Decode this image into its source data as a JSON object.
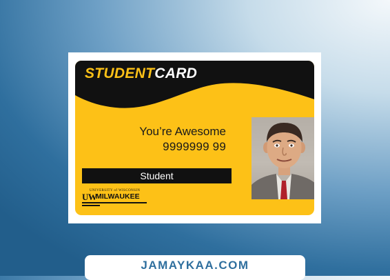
{
  "card": {
    "title_part1": "STUDENT",
    "title_part2": "CARD",
    "holder_name": "You’re Awesome",
    "holder_number": "9999999 99",
    "role": "Student",
    "logo": {
      "small_text": "UNIVERSITY of WISCONSIN",
      "initials": "UW",
      "name": "MILWAUKEE"
    }
  },
  "footer": {
    "site": "JAMAYKAA.COM"
  },
  "colors": {
    "card_yellow": "#fdc117",
    "card_black": "#111111",
    "footer_text": "#2f6f9e"
  },
  "icons": {
    "photo": "portrait-photo-icon"
  }
}
